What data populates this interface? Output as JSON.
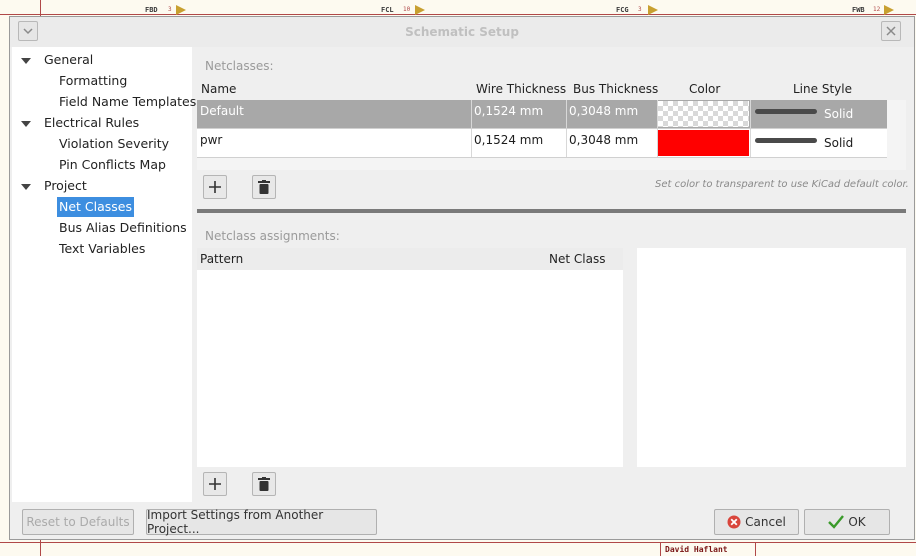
{
  "dialog": {
    "title": "Schematic Setup",
    "menu_icon": "chevron-down-icon",
    "close_icon": "close-icon"
  },
  "background": {
    "labels": [
      "FBD",
      "FCL",
      "FCG",
      "FWB"
    ],
    "footer_name": "David Haflant"
  },
  "tree": {
    "items": [
      {
        "label": "General",
        "level": 0,
        "expanded": true
      },
      {
        "label": "Formatting",
        "level": 1
      },
      {
        "label": "Field Name Templates",
        "level": 1
      },
      {
        "label": "Electrical Rules",
        "level": 0,
        "expanded": true
      },
      {
        "label": "Violation Severity",
        "level": 1
      },
      {
        "label": "Pin Conflicts Map",
        "level": 1
      },
      {
        "label": "Project",
        "level": 0,
        "expanded": true
      },
      {
        "label": "Net Classes",
        "level": 1,
        "selected": true
      },
      {
        "label": "Bus Alias Definitions",
        "level": 1
      },
      {
        "label": "Text Variables",
        "level": 1
      }
    ]
  },
  "netclasses": {
    "section_label": "Netclasses:",
    "columns": [
      "Name",
      "Wire Thickness",
      "Bus Thickness",
      "Color",
      "Line Style"
    ],
    "rows": [
      {
        "name": "Default",
        "wire": "0,1524 mm",
        "bus": "0,3048 mm",
        "color": "transparent",
        "style": "Solid"
      },
      {
        "name": "pwr",
        "wire": "0,1524 mm",
        "bus": "0,3048 mm",
        "color": "#ff0000",
        "style": "Solid"
      }
    ],
    "hint": "Set color to transparent to use KiCad default color."
  },
  "assignments": {
    "section_label": "Netclass assignments:",
    "columns": [
      "Pattern",
      "Net Class"
    ]
  },
  "footer": {
    "reset_label": "Reset to Defaults",
    "import_label": "Import Settings from Another Project...",
    "cancel_label": "Cancel",
    "ok_label": "OK"
  }
}
